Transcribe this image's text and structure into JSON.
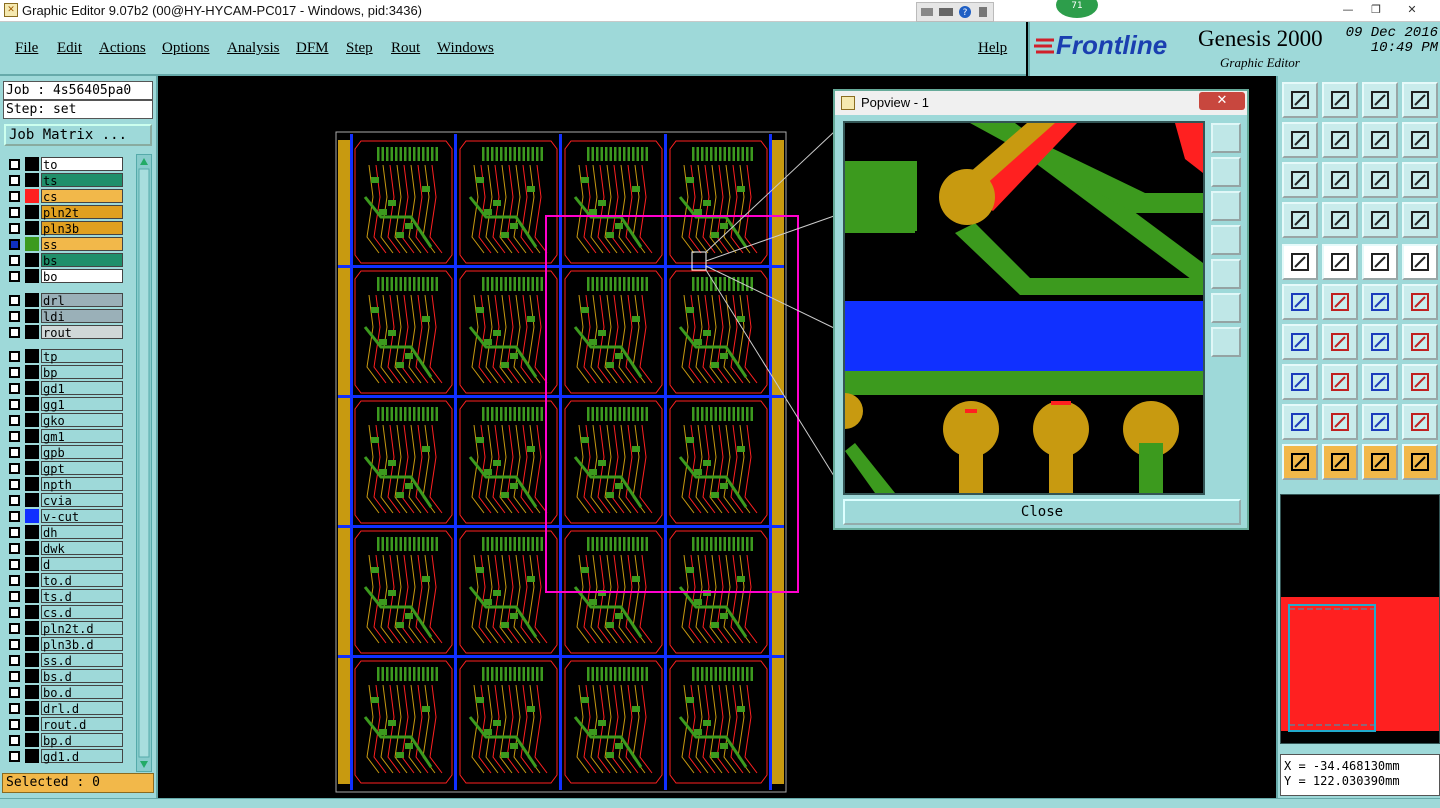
{
  "window": {
    "title": "Graphic Editor 9.07b2 (00@HY-HYCAM-PC017 - Windows, pid:3436)",
    "tray_badge": "71",
    "minimize": "—",
    "maximize": "❐",
    "close": "✕"
  },
  "menu": {
    "items": [
      "File",
      "Edit",
      "Actions",
      "Options",
      "Analysis",
      "DFM",
      "Step",
      "Rout",
      "Windows"
    ],
    "help": "Help"
  },
  "brand": {
    "logo": "Frontline",
    "product": "Genesis 2000",
    "subtitle": "Graphic Editor",
    "date": "09 Dec 2016",
    "time": "10:49 PM"
  },
  "job": {
    "job_label": "Job : 4s56405pa0",
    "step_label": "Step: set",
    "matrix_button": "Job Matrix ..."
  },
  "layers": {
    "group1": [
      {
        "name": "to",
        "color": "#ffffff",
        "swatch": "#000000",
        "active": false
      },
      {
        "name": "ts",
        "color": "#1f8f6a",
        "swatch": "#000000",
        "active": false
      },
      {
        "name": "cs",
        "color": "#f2b84a",
        "swatch": "#ff2020",
        "active": false
      },
      {
        "name": "pln2t",
        "color": "#e0a020",
        "swatch": "#000000",
        "active": false
      },
      {
        "name": "pln3b",
        "color": "#e0a020",
        "swatch": "#000000",
        "active": false
      },
      {
        "name": "ss",
        "color": "#f2b84a",
        "swatch": "#3c9a1e",
        "active": true
      },
      {
        "name": "bs",
        "color": "#1f8f6a",
        "swatch": "#000000",
        "active": false
      },
      {
        "name": "bo",
        "color": "#ffffff",
        "swatch": "#000000",
        "active": false
      }
    ],
    "group2": [
      {
        "name": "drl",
        "color": "#9ab0b8",
        "swatch": "#000000",
        "active": false
      },
      {
        "name": "ldi",
        "color": "#9ab0b8",
        "swatch": "#000000",
        "active": false
      },
      {
        "name": "rout",
        "color": "#d0d8d8",
        "swatch": "#000000",
        "active": false
      }
    ],
    "group3": [
      {
        "name": "tp",
        "color": "#9ed9d9",
        "swatch": "#000000",
        "active": false
      },
      {
        "name": "bp",
        "color": "#9ed9d9",
        "swatch": "#000000",
        "active": false
      },
      {
        "name": "gd1",
        "color": "#9ed9d9",
        "swatch": "#000000",
        "active": false
      },
      {
        "name": "gg1",
        "color": "#9ed9d9",
        "swatch": "#000000",
        "active": false
      },
      {
        "name": "gko",
        "color": "#9ed9d9",
        "swatch": "#000000",
        "active": false
      },
      {
        "name": "gm1",
        "color": "#9ed9d9",
        "swatch": "#000000",
        "active": false
      },
      {
        "name": "gpb",
        "color": "#9ed9d9",
        "swatch": "#000000",
        "active": false
      },
      {
        "name": "gpt",
        "color": "#9ed9d9",
        "swatch": "#000000",
        "active": false
      },
      {
        "name": "npth",
        "color": "#9ed9d9",
        "swatch": "#000000",
        "active": false
      },
      {
        "name": "cvia",
        "color": "#9ed9d9",
        "swatch": "#000000",
        "active": false
      },
      {
        "name": "v-cut",
        "color": "#9ed9d9",
        "swatch": "#1030ff",
        "active": false
      },
      {
        "name": "dh",
        "color": "#9ed9d9",
        "swatch": "#000000",
        "active": false
      },
      {
        "name": "dwk",
        "color": "#9ed9d9",
        "swatch": "#000000",
        "active": false
      },
      {
        "name": "d",
        "color": "#9ed9d9",
        "swatch": "#000000",
        "active": false
      },
      {
        "name": "to.d",
        "color": "#9ed9d9",
        "swatch": "#000000",
        "active": false
      },
      {
        "name": "ts.d",
        "color": "#9ed9d9",
        "swatch": "#000000",
        "active": false
      },
      {
        "name": "cs.d",
        "color": "#9ed9d9",
        "swatch": "#000000",
        "active": false
      },
      {
        "name": "pln2t.d",
        "color": "#9ed9d9",
        "swatch": "#000000",
        "active": false
      },
      {
        "name": "pln3b.d",
        "color": "#9ed9d9",
        "swatch": "#000000",
        "active": false
      },
      {
        "name": "ss.d",
        "color": "#9ed9d9",
        "swatch": "#000000",
        "active": false
      },
      {
        "name": "bs.d",
        "color": "#9ed9d9",
        "swatch": "#000000",
        "active": false
      },
      {
        "name": "bo.d",
        "color": "#9ed9d9",
        "swatch": "#000000",
        "active": false
      },
      {
        "name": "drl.d",
        "color": "#9ed9d9",
        "swatch": "#000000",
        "active": false
      },
      {
        "name": "rout.d",
        "color": "#9ed9d9",
        "swatch": "#000000",
        "active": false
      },
      {
        "name": "bp.d",
        "color": "#9ed9d9",
        "swatch": "#000000",
        "active": false
      },
      {
        "name": "gd1.d",
        "color": "#9ed9d9",
        "swatch": "#000000",
        "active": false
      }
    ]
  },
  "selected": "Selected : 0",
  "popview": {
    "title": "Popview - 1",
    "close_label": "Close",
    "close_x": "✕"
  },
  "coords": {
    "x": "X = -34.468130mm",
    "y": "Y = 122.030390mm"
  },
  "colors": {
    "panel": "#9ed9d9",
    "board_copper": "#c89a10",
    "trace_green": "#3c9a1e",
    "trace_red": "#ff2020",
    "vcut_blue": "#1030ff",
    "zoom_box": "#ff00cc"
  },
  "icons": {
    "tools": [
      "gear-icon",
      "zoom-icon",
      "pan-icon",
      "fit-icon",
      "measure-icon",
      "snap-icon",
      "select-icon",
      "cursor-icon"
    ]
  }
}
